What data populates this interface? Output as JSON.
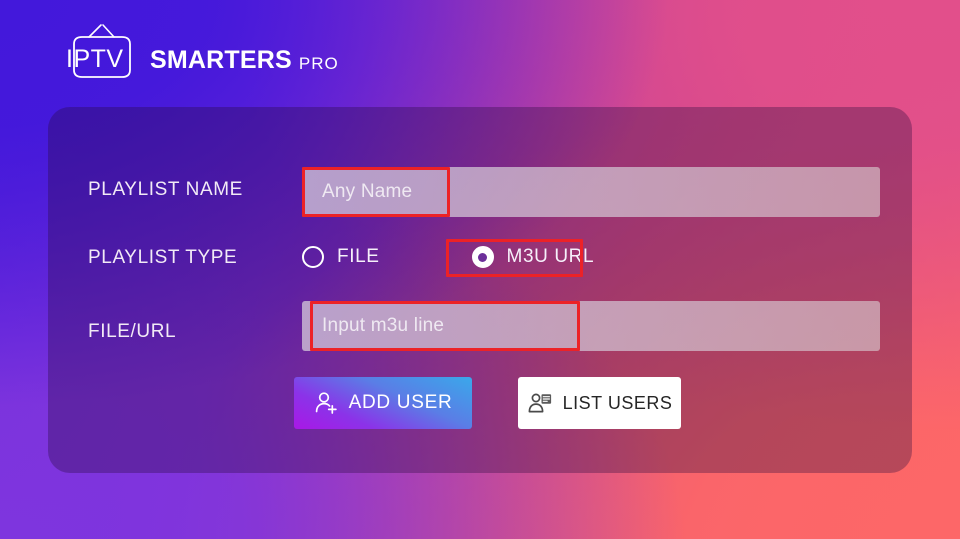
{
  "app": {
    "logo": {
      "icon": "tv-icon",
      "word_in_tv": "IPTV",
      "brand": "SMARTERS",
      "suffix": "PRO"
    }
  },
  "form": {
    "fields": [
      {
        "name": "playlist-name",
        "label": "PLAYLIST NAME",
        "type": "text",
        "value": "Any Name",
        "highlighted": true
      },
      {
        "name": "playlist-type",
        "label": "PLAYLIST TYPE",
        "type": "radio",
        "options": [
          {
            "label": "FILE",
            "selected": false,
            "highlighted": false
          },
          {
            "label": "M3U URL",
            "selected": true,
            "highlighted": true
          }
        ]
      },
      {
        "name": "file-url",
        "label": "FILE/URL",
        "type": "text",
        "value": "Input m3u line",
        "highlighted": true
      }
    ],
    "buttons": [
      {
        "name": "add-user",
        "label": "ADD USER",
        "icon": "user-plus-icon",
        "highlighted": true
      },
      {
        "name": "list-users",
        "label": "LIST USERS",
        "icon": "user-list-icon",
        "highlighted": false
      }
    ]
  },
  "colors": {
    "highlight_border": "#ec2227",
    "bg_top_left": "#4318db",
    "bg_top_right": "#e24f8b",
    "bg_bottom_left": "#7e35de",
    "bg_bottom_right": "#fd6768",
    "add_user_gradient_from": "#3aa8ea",
    "add_user_gradient_to": "#a918e6",
    "list_users_bg": "#ffffff"
  }
}
